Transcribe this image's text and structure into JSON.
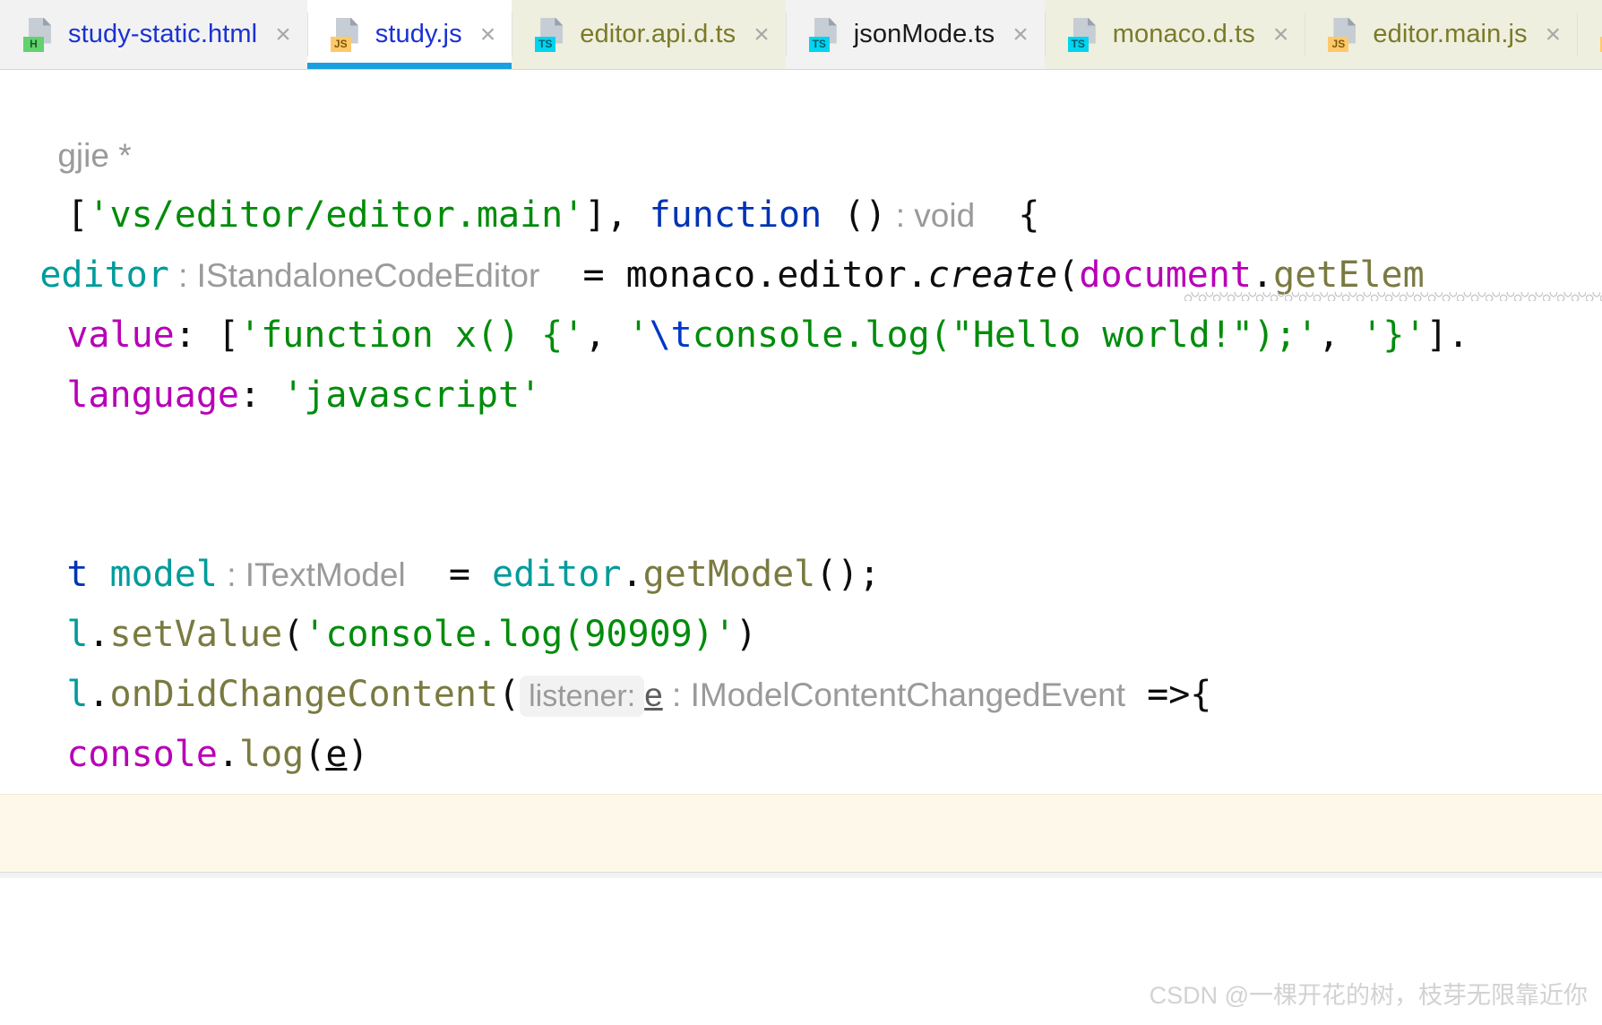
{
  "window": {
    "app": "WebStorm Editor",
    "accent_color": "#1a9fe0",
    "editor_background": "#ffffff"
  },
  "tabs": [
    {
      "label": "study-static.html",
      "filetype": "HTML",
      "badge": "H",
      "badge_class": "html",
      "state": "inactive",
      "label_color": "#1a32d2",
      "close_label": "×"
    },
    {
      "label": "study.js",
      "filetype": "JS",
      "badge": "JS",
      "badge_class": "js",
      "state": "active",
      "label_color": "#1a32d2",
      "close_label": "×"
    },
    {
      "label": "editor.api.d.ts",
      "filetype": "TS",
      "badge": "TS",
      "badge_class": "ts",
      "state": "library",
      "label_color": "#7a7a29",
      "close_label": "×"
    },
    {
      "label": "jsonMode.ts",
      "filetype": "TS",
      "badge": "TS",
      "badge_class": "ts",
      "state": "inactive",
      "label_color": "#1a1a1a",
      "close_label": "×"
    },
    {
      "label": "monaco.d.ts",
      "filetype": "TS",
      "badge": "TS",
      "badge_class": "ts",
      "state": "library",
      "label_color": "#7a7a29",
      "close_label": "×"
    },
    {
      "label": "editor.main.js",
      "filetype": "JS",
      "badge": "JS",
      "badge_class": "js",
      "state": "library",
      "label_color": "#7a7a29",
      "close_label": "×"
    },
    {
      "label": "",
      "filetype": "JS",
      "badge": "JS",
      "badge_class": "js",
      "state": "library",
      "label_color": "#7a7a29",
      "close_label": ""
    }
  ],
  "code": {
    "note": "Editor is horizontally scrolled; the leftmost characters of each line are clipped off-screen.",
    "lines": [
      {
        "id": "line-comment",
        "tokens": [
          {
            "text": "gjie *",
            "kind": "comment"
          }
        ]
      },
      {
        "id": "line-require",
        "tokens": [
          {
            "text": "[",
            "kind": "plain"
          },
          {
            "text": "'vs/editor/editor.main'",
            "kind": "string"
          },
          {
            "text": "], ",
            "kind": "plain"
          },
          {
            "text": "function",
            "kind": "keyword"
          },
          {
            "text": " ()",
            "kind": "plain"
          },
          {
            "text": " : void",
            "kind": "hint"
          },
          {
            "text": "  {",
            "kind": "plain"
          }
        ]
      },
      {
        "id": "line-create-editor",
        "tokens": [
          {
            "text": "editor",
            "kind": "local"
          },
          {
            "text": " : IStandaloneCodeEditor",
            "kind": "hint"
          },
          {
            "text": "  = ",
            "kind": "plain"
          },
          {
            "text": "monaco",
            "kind": "plain"
          },
          {
            "text": ".editor.",
            "kind": "plain"
          },
          {
            "text": "create",
            "kind": "plain-italic"
          },
          {
            "text": "(",
            "kind": "plain"
          },
          {
            "text": "document",
            "kind": "field"
          },
          {
            "text": ".",
            "kind": "plain"
          },
          {
            "text": "getElem",
            "kind": "function"
          }
        ]
      },
      {
        "id": "line-value",
        "tokens": [
          {
            "text": "value",
            "kind": "field"
          },
          {
            "text": ": [",
            "kind": "plain"
          },
          {
            "text": "'function x() {'",
            "kind": "string"
          },
          {
            "text": ", ",
            "kind": "plain"
          },
          {
            "text": "'",
            "kind": "string"
          },
          {
            "text": "\\t",
            "kind": "escape"
          },
          {
            "text": "console.log(\"Hello world!\");'",
            "kind": "string"
          },
          {
            "text": ", ",
            "kind": "plain"
          },
          {
            "text": "'}'",
            "kind": "string"
          },
          {
            "text": "].",
            "kind": "plain"
          }
        ]
      },
      {
        "id": "line-language",
        "tokens": [
          {
            "text": "language",
            "kind": "field"
          },
          {
            "text": ": ",
            "kind": "plain"
          },
          {
            "text": "'javascript'",
            "kind": "string"
          }
        ]
      },
      {
        "id": "line-get-model",
        "tokens": [
          {
            "text": "t ",
            "kind": "keyword"
          },
          {
            "text": "model",
            "kind": "local"
          },
          {
            "text": " : ITextModel",
            "kind": "hint"
          },
          {
            "text": "  = ",
            "kind": "plain"
          },
          {
            "text": "editor",
            "kind": "local"
          },
          {
            "text": ".",
            "kind": "plain"
          },
          {
            "text": "getModel",
            "kind": "function"
          },
          {
            "text": "();",
            "kind": "plain"
          }
        ]
      },
      {
        "id": "line-set-value",
        "tokens": [
          {
            "text": "l",
            "kind": "local"
          },
          {
            "text": ".",
            "kind": "plain"
          },
          {
            "text": "setValue",
            "kind": "function"
          },
          {
            "text": "(",
            "kind": "plain"
          },
          {
            "text": "'console.log(90909)'",
            "kind": "string"
          },
          {
            "text": ")",
            "kind": "plain"
          }
        ]
      },
      {
        "id": "line-on-did-change",
        "tokens": [
          {
            "text": "l",
            "kind": "local"
          },
          {
            "text": ".",
            "kind": "plain"
          },
          {
            "text": "onDidChangeContent",
            "kind": "function"
          },
          {
            "text": "(",
            "kind": "plain"
          },
          {
            "text": "listener:",
            "kind": "hint-box"
          },
          {
            "text": "e",
            "kind": "hint-dark-underline"
          },
          {
            "text": " : IModelContentChangedEvent",
            "kind": "hint"
          },
          {
            "text": " =>{",
            "kind": "plain"
          }
        ]
      },
      {
        "id": "line-console-log-e",
        "tokens": [
          {
            "text": "console",
            "kind": "field"
          },
          {
            "text": ".",
            "kind": "plain"
          },
          {
            "text": "log",
            "kind": "function"
          },
          {
            "text": "(",
            "kind": "plain"
          },
          {
            "text": "e",
            "kind": "plain-underline"
          },
          {
            "text": ")",
            "kind": "plain"
          }
        ]
      }
    ],
    "error_squiggle": {
      "present": true,
      "under_text": "document.getElem",
      "color": "#c9c9c9"
    }
  },
  "panels": {
    "warning_band_color": "#fdf8e9",
    "console_background": "#ffffff"
  },
  "watermark": {
    "text": "CSDN @一棵开花的树，枝芽无限靠近你"
  }
}
